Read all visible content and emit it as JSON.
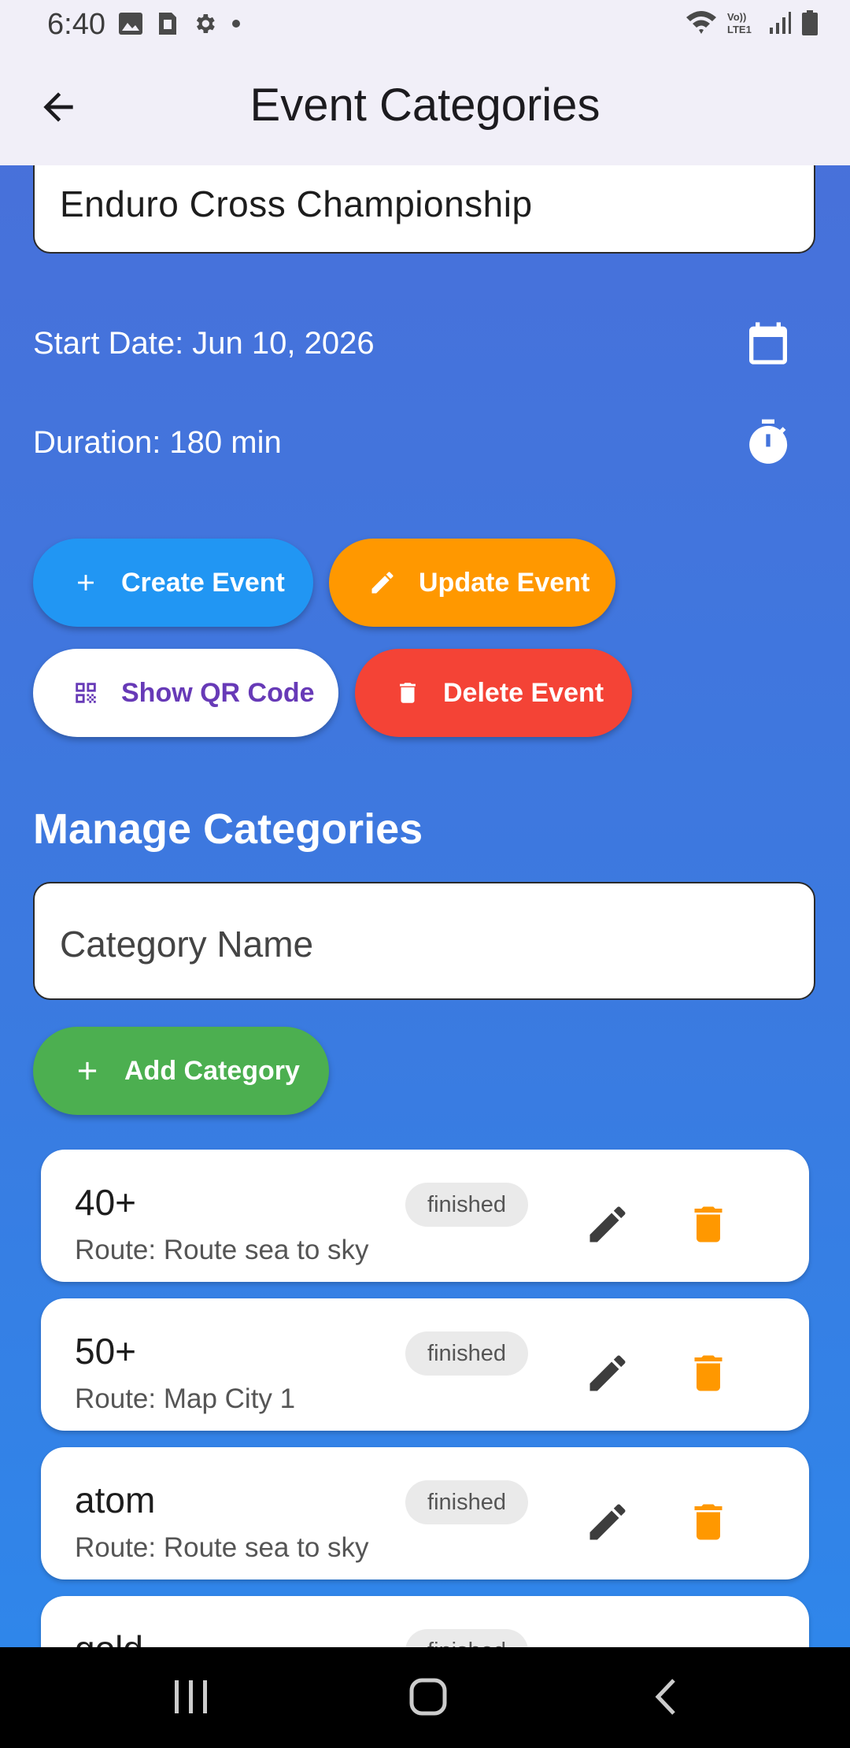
{
  "status_bar": {
    "time": "6:40",
    "left_icons": [
      "image-icon",
      "sim-card-icon",
      "settings-icon",
      "dot-icon"
    ],
    "right_icons": [
      "wifi-icon",
      "volte-icon",
      "signal-icon",
      "battery-icon"
    ]
  },
  "app_bar": {
    "title": "Event Categories",
    "back_icon": "arrow-back-icon"
  },
  "event": {
    "name": "Enduro Cross Championship",
    "start_date": "Start Date: Jun 10, 2026",
    "duration": "Duration: 180 min"
  },
  "buttons": {
    "create": "Create Event",
    "update": "Update Event",
    "qr": "Show QR Code",
    "delete": "Delete Event",
    "add_category": "Add Category"
  },
  "categories_section": {
    "title": "Manage Categories",
    "input_placeholder": "Category Name",
    "items": [
      {
        "name": "40+",
        "route": "Route: Route sea to sky",
        "status": "finished"
      },
      {
        "name": "50+",
        "route": "Route: Map City 1",
        "status": "finished"
      },
      {
        "name": "atom",
        "route": "Route: Route sea to sky",
        "status": "finished"
      },
      {
        "name": "gold",
        "route": "",
        "status": "finished"
      }
    ]
  },
  "colors": {
    "create": "#2196f3",
    "update": "#ff9800",
    "delete": "#f44336",
    "add": "#4caf50",
    "qr_text": "#673ab7",
    "trash": "#ff9800"
  }
}
